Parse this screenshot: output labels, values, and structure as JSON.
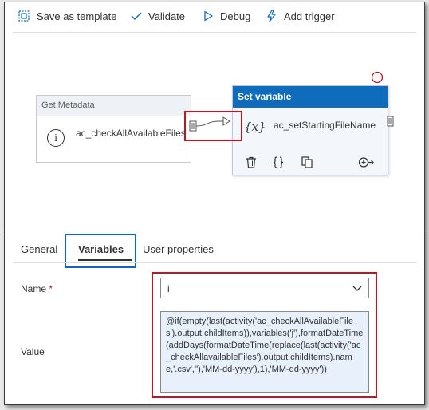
{
  "toolbar": {
    "save_as_template": "Save as template",
    "validate": "Validate",
    "debug": "Debug",
    "add_trigger": "Add trigger"
  },
  "canvas": {
    "get_metadata": {
      "type_label": "Get Metadata",
      "name": "ac_checkAllAvailableFiles",
      "icon": "info-icon"
    },
    "set_variable": {
      "type_label": "Set variable",
      "name": "ac_setStartingFileName",
      "icon": "variable-icon",
      "icon_glyph": "{x}",
      "actions": [
        "delete-icon",
        "code-icon",
        "copy-icon",
        "add-output-icon"
      ]
    },
    "colors": {
      "accent": "#0f6cbd",
      "highlight_red": "#c0141e",
      "highlight_blue": "#1565c0"
    }
  },
  "tabs": [
    {
      "label": "General",
      "active": false
    },
    {
      "label": "Variables",
      "active": true
    },
    {
      "label": "User properties",
      "active": false
    }
  ],
  "form": {
    "name_label": "Name",
    "required_marker": "*",
    "name_value": "i",
    "value_label": "Value",
    "value_text": "@if(empty(last(activity('ac_checkAllAvailableFiles').output.childItems)),variables('j'),formatDateTime(addDays(formatDateTime(replace(last(activity('ac_checkAllavailableFiles').output.childItems).name,'.csv',''),'MM-dd-yyyy'),1),'MM-dd-yyyy'))"
  }
}
